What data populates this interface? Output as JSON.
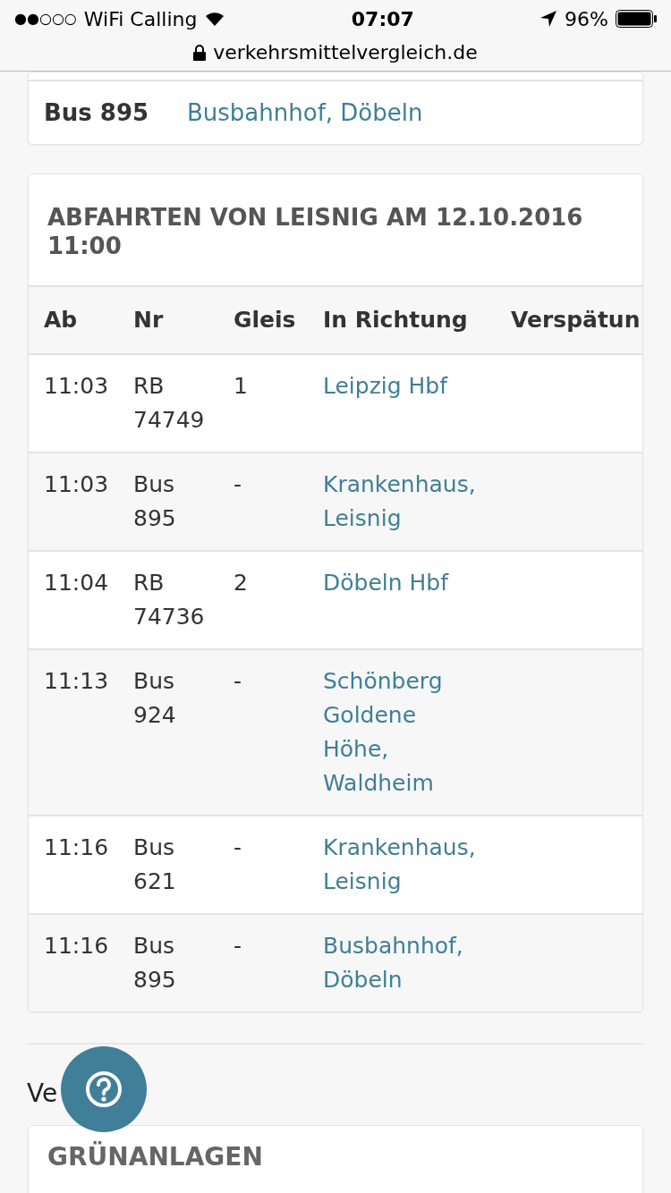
{
  "status_bar": {
    "signal": "●●○○○",
    "carrier": "WiFi Calling",
    "time": "07:07",
    "battery": "96%"
  },
  "address_bar": {
    "url": "verkehrsmittelvergleich.de"
  },
  "previous_card": {
    "rows": [
      {
        "line": "Bus 895",
        "destination": "Busbahnhof, Döbeln"
      }
    ]
  },
  "departures": {
    "title": "ABFAHRTEN VON LEISNIG AM 12.10.2016 11:00",
    "columns": [
      "Ab",
      "Nr",
      "Gleis",
      "In Richtung",
      "Verspätun"
    ],
    "rows": [
      {
        "time": "11:03",
        "number": "RB 74749",
        "platform": "1",
        "direction": "Leipzig Hbf"
      },
      {
        "time": "11:03",
        "number": "Bus 895",
        "platform": "-",
        "direction": "Krankenhaus, Leisnig"
      },
      {
        "time": "11:04",
        "number": "RB 74736",
        "platform": "2",
        "direction": "Döbeln Hbf"
      },
      {
        "time": "11:13",
        "number": "Bus 924",
        "platform": "-",
        "direction": "Schönberg Goldene Höhe, Waldheim"
      },
      {
        "time": "11:16",
        "number": "Bus 621",
        "platform": "-",
        "direction": "Krankenhaus, Leisnig"
      },
      {
        "time": "11:16",
        "number": "Bus 895",
        "platform": "-",
        "direction": "Busbahnhof, Döbeln"
      }
    ]
  },
  "section_heading": "Ve",
  "next_card": {
    "title": "GRÜNANLAGEN"
  }
}
